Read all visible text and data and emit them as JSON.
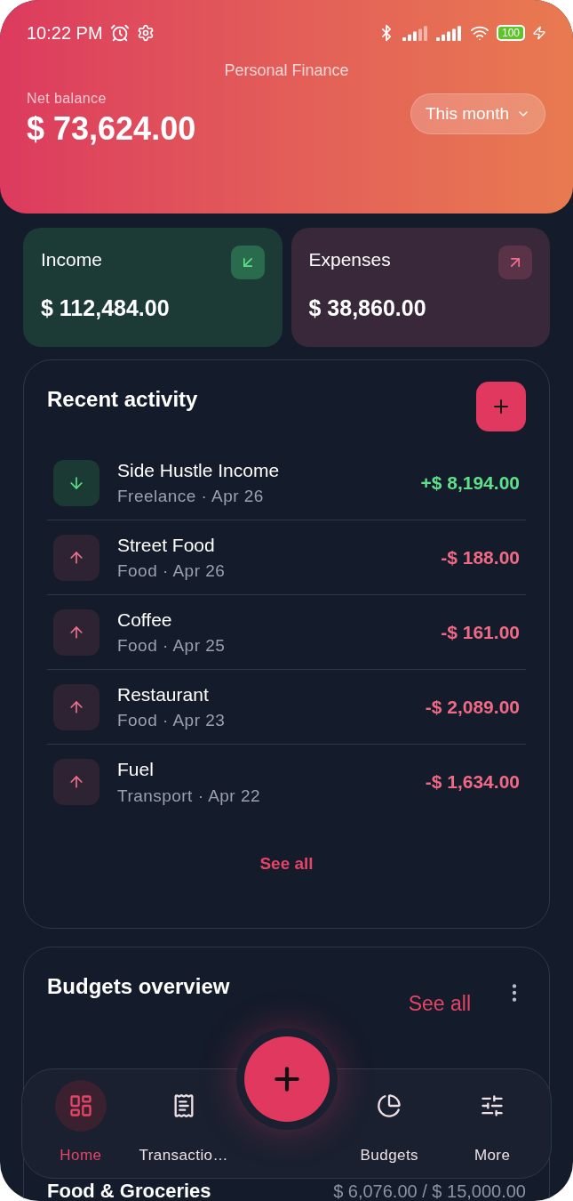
{
  "status_bar": {
    "time": "10:22 PM",
    "battery": "100"
  },
  "header": {
    "title": "Personal Finance",
    "balance_label": "Net balance",
    "balance": "$ 73,624.00",
    "period": "This month"
  },
  "summary": [
    {
      "kind": "income",
      "label": "Income",
      "amount": "$ 112,484.00"
    },
    {
      "kind": "expense",
      "label": "Expenses",
      "amount": "$ 38,860.00"
    }
  ],
  "recent": {
    "title": "Recent activity",
    "see_all": "See all",
    "items": [
      {
        "kind": "income",
        "name": "Side Hustle Income",
        "meta": "Freelance · Apr 26",
        "amount": "+$ 8,194.00"
      },
      {
        "kind": "expense",
        "name": "Street Food",
        "meta": "Food · Apr 26",
        "amount": "-$ 188.00"
      },
      {
        "kind": "expense",
        "name": "Coffee",
        "meta": "Food · Apr 25",
        "amount": "-$ 161.00"
      },
      {
        "kind": "expense",
        "name": "Restaurant",
        "meta": "Food · Apr 23",
        "amount": "-$ 2,089.00"
      },
      {
        "kind": "expense",
        "name": "Fuel",
        "meta": "Transport · Apr 22",
        "amount": "-$ 1,634.00"
      }
    ]
  },
  "budgets": {
    "title": "Budgets overview",
    "see_all": "See all",
    "rows": [
      {
        "name": "Food & Groceries",
        "amount": "$ 6,076.00 / $ 15,000.00"
      }
    ]
  },
  "nav": [
    {
      "kind": "home",
      "label": "Home",
      "selected": true
    },
    {
      "kind": "transactions",
      "label": "Transactio…",
      "selected": false
    },
    {
      "kind": "budgets",
      "label": "Budgets",
      "selected": false
    },
    {
      "kind": "more",
      "label": "More",
      "selected": false
    }
  ]
}
